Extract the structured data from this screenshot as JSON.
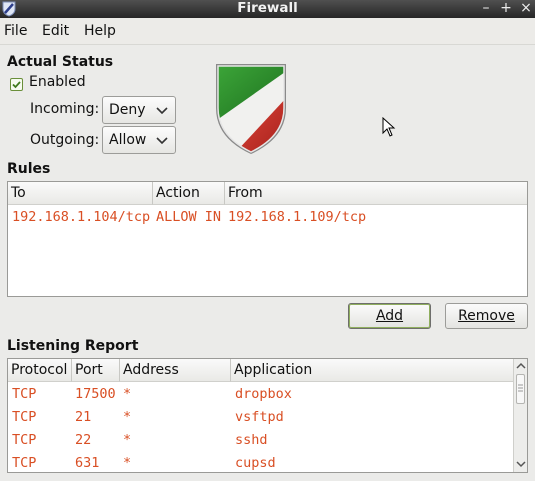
{
  "window": {
    "title": "Firewall",
    "minimize": "–",
    "maximize": "+",
    "close": "×"
  },
  "menu": [
    {
      "label": "File"
    },
    {
      "label": "Edit"
    },
    {
      "label": "Help"
    }
  ],
  "status": {
    "heading": "Actual Status",
    "enabled_label": "Enabled",
    "enabled_checked": true,
    "incoming_label": "Incoming:",
    "incoming_value": "Deny",
    "outgoing_label": "Outgoing:",
    "outgoing_value": "Allow"
  },
  "rules": {
    "heading": "Rules",
    "columns": [
      "To",
      "Action",
      "From"
    ],
    "rows": [
      {
        "to": "192.168.1.104/tcp",
        "action": "ALLOW IN",
        "from": "192.168.1.109/tcp"
      }
    ],
    "add_label": "Add",
    "remove_label": "Remove"
  },
  "listening": {
    "heading": "Listening Report",
    "columns": [
      "Protocol",
      "Port",
      "Address",
      "Application"
    ],
    "rows": [
      {
        "protocol": "TCP",
        "port": "17500",
        "address": "*",
        "application": "dropbox"
      },
      {
        "protocol": "TCP",
        "port": "21",
        "address": "*",
        "application": "vsftpd"
      },
      {
        "protocol": "TCP",
        "port": "22",
        "address": "*",
        "application": "sshd"
      },
      {
        "protocol": "TCP",
        "port": "631",
        "address": "*",
        "application": "cupsd"
      }
    ]
  },
  "colors": {
    "rule_text": "#d94f24",
    "titlebar": "#3a3a3a"
  }
}
